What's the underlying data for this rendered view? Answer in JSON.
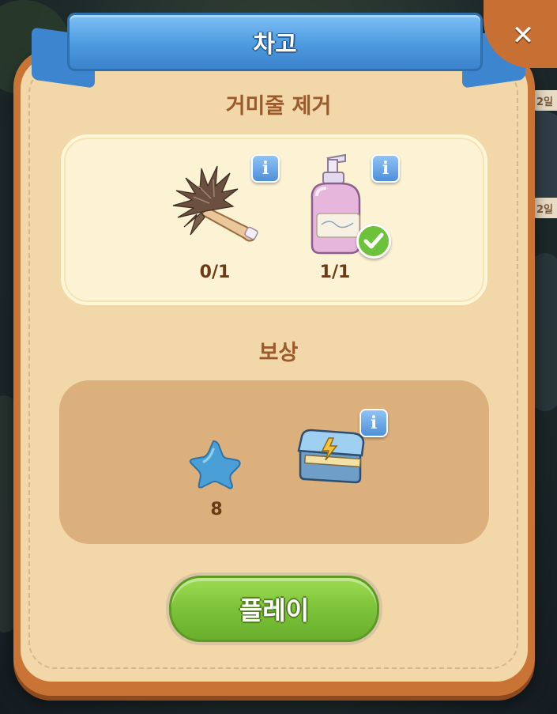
{
  "dialog": {
    "title": "차고",
    "close_label": "✕"
  },
  "task_section": {
    "title": "거미줄 제거",
    "items": [
      {
        "icon": "feather-duster-icon",
        "count": "0/1",
        "completed": false
      },
      {
        "icon": "soap-bottle-icon",
        "count": "1/1",
        "completed": true
      }
    ],
    "info_label": "i"
  },
  "reward_section": {
    "title": "보상",
    "items": [
      {
        "icon": "star-icon",
        "count": "8"
      },
      {
        "icon": "energy-chest-icon",
        "count": ""
      }
    ],
    "info_label": "i"
  },
  "play_button": {
    "label": "플레이"
  },
  "background": {
    "tags": [
      "2일",
      "2일"
    ]
  },
  "colors": {
    "panel_border": "#c97434",
    "panel_fill": "#f2d7a9",
    "ribbon": "#4d9ae0",
    "play_button": "#7cc23a",
    "title_text": "#9a5a2c"
  }
}
